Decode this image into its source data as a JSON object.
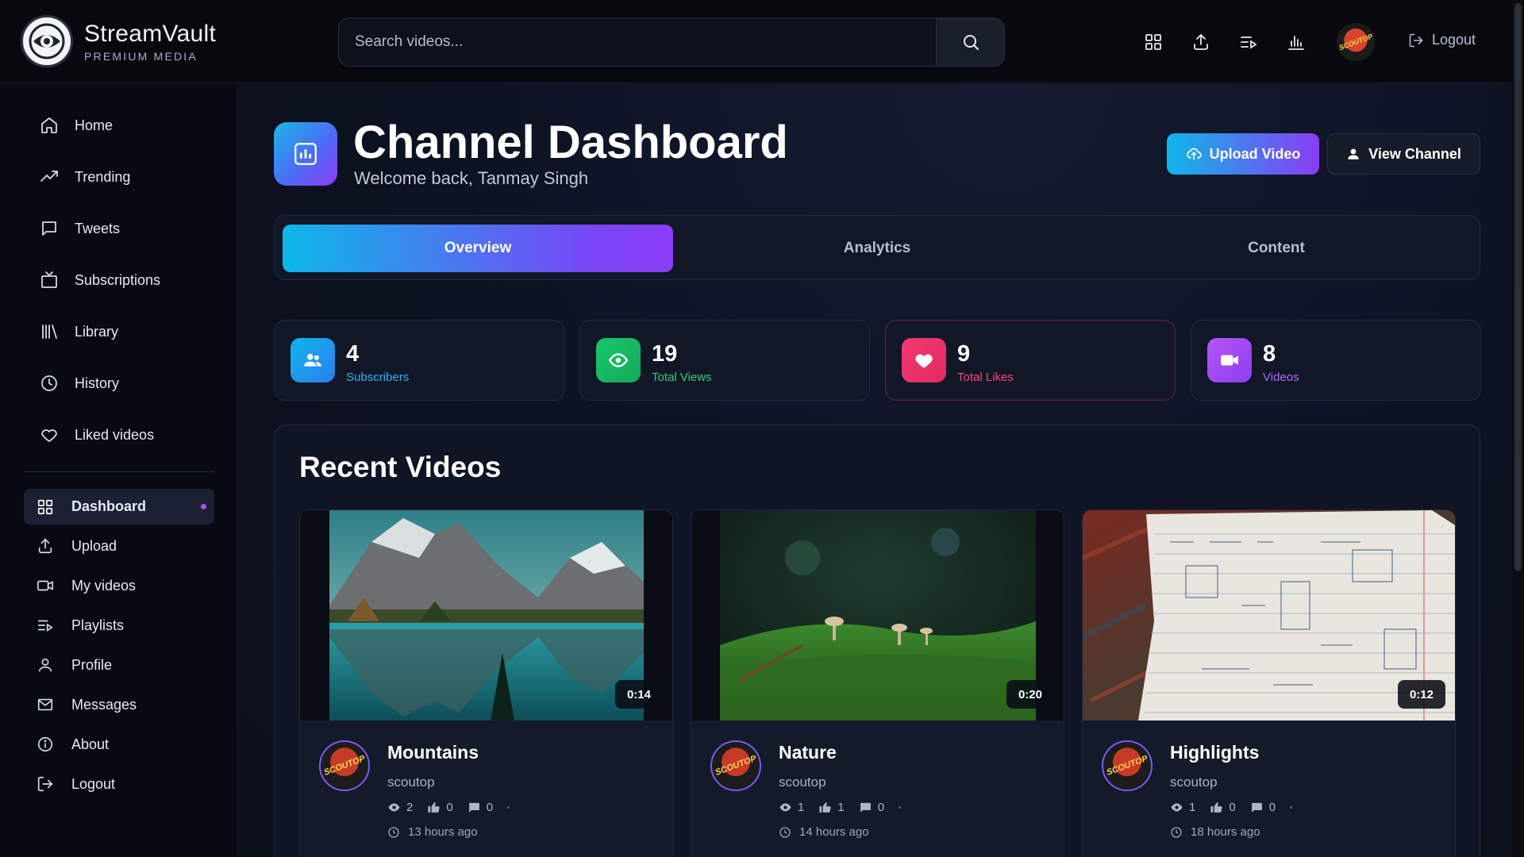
{
  "app": {
    "name": "StreamVault",
    "tagline": "PREMIUM MEDIA"
  },
  "search": {
    "placeholder": "Search videos..."
  },
  "header": {
    "logout_label": "Logout",
    "icons": [
      "grid-icon",
      "upload-icon",
      "playlist-icon",
      "bar-chart-icon"
    ]
  },
  "sidebar": {
    "primary": [
      {
        "label": "Home",
        "icon": "home-icon"
      },
      {
        "label": "Trending",
        "icon": "trending-icon"
      },
      {
        "label": "Tweets",
        "icon": "chat-icon"
      },
      {
        "label": "Subscriptions",
        "icon": "tv-icon"
      },
      {
        "label": "Library",
        "icon": "library-icon"
      },
      {
        "label": "History",
        "icon": "clock-icon"
      },
      {
        "label": "Liked videos",
        "icon": "heart-icon"
      }
    ],
    "secondary": [
      {
        "label": "Dashboard",
        "icon": "grid-icon",
        "active": true
      },
      {
        "label": "Upload",
        "icon": "upload-icon"
      },
      {
        "label": "My videos",
        "icon": "video-camera-icon"
      },
      {
        "label": "Playlists",
        "icon": "playlist-icon"
      },
      {
        "label": "Profile",
        "icon": "user-icon"
      },
      {
        "label": "Messages",
        "icon": "mail-icon"
      },
      {
        "label": "About",
        "icon": "info-icon"
      },
      {
        "label": "Logout",
        "icon": "logout-icon"
      }
    ]
  },
  "page": {
    "title": "Channel Dashboard",
    "subtitle": "Welcome back, Tanmay Singh",
    "upload_button": "Upload Video",
    "view_channel_button": "View Channel"
  },
  "tabs": [
    {
      "label": "Overview",
      "active": true
    },
    {
      "label": "Analytics",
      "active": false
    },
    {
      "label": "Content",
      "active": false
    }
  ],
  "stats": [
    {
      "value": "4",
      "label": "Subscribers",
      "color": "#1ba3f0"
    },
    {
      "value": "19",
      "label": "Total Views",
      "color": "#1fc46a"
    },
    {
      "value": "9",
      "label": "Total Likes",
      "color": "#f0306e"
    },
    {
      "value": "8",
      "label": "Videos",
      "color": "#a24df5"
    }
  ],
  "recent": {
    "title": "Recent Videos",
    "videos": [
      {
        "title": "Mountains",
        "channel": "scoutop",
        "duration": "0:14",
        "views": "2",
        "likes": "0",
        "comments": "0",
        "time": "13 hours ago",
        "avatar_text": "SCOUTOP"
      },
      {
        "title": "Nature",
        "channel": "scoutop",
        "duration": "0:20",
        "views": "1",
        "likes": "1",
        "comments": "0",
        "time": "14 hours ago",
        "avatar_text": "SCOUTOP"
      },
      {
        "title": "Highlights",
        "channel": "scoutop",
        "duration": "0:12",
        "views": "1",
        "likes": "0",
        "comments": "0",
        "time": "18 hours ago",
        "avatar_text": "SCOUTOP"
      }
    ]
  },
  "user": {
    "avatar_text": "SCOUTOP"
  },
  "colors": {
    "accent_cyan": "#0fb6e9",
    "accent_purple": "#8a3df5",
    "background": "#0b0f1a"
  }
}
